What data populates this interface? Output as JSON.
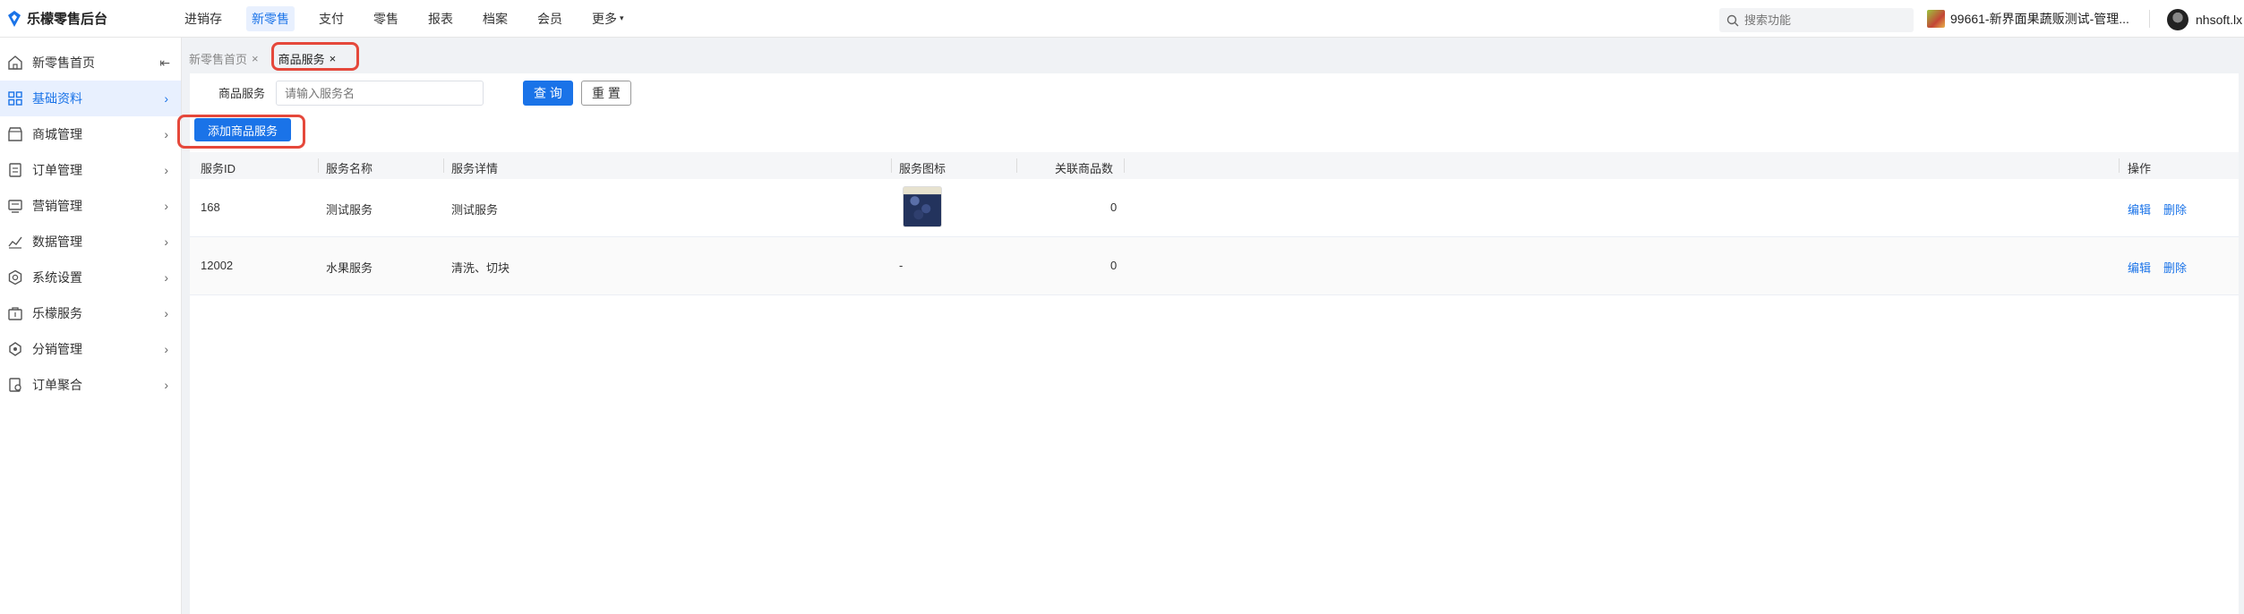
{
  "app": {
    "title": "乐檬零售后台"
  },
  "topnav": {
    "items": [
      "进销存",
      "新零售",
      "支付",
      "零售",
      "报表",
      "档案",
      "会员"
    ],
    "more": "更多"
  },
  "search": {
    "placeholder": "搜索功能"
  },
  "store": {
    "name": "99661-新界面果蔬贩测试-管理..."
  },
  "user": {
    "name": "nhsoft.lx"
  },
  "sidebar": {
    "items": [
      {
        "label": "新零售首页",
        "icon": "home-icon"
      },
      {
        "label": "基础资料",
        "icon": "grid-icon"
      },
      {
        "label": "商城管理",
        "icon": "store-icon"
      },
      {
        "label": "订单管理",
        "icon": "order-icon"
      },
      {
        "label": "营销管理",
        "icon": "marketing-icon"
      },
      {
        "label": "数据管理",
        "icon": "chart-icon"
      },
      {
        "label": "系统设置",
        "icon": "settings-icon"
      },
      {
        "label": "乐檬服务",
        "icon": "service-icon"
      },
      {
        "label": "分销管理",
        "icon": "distribution-icon"
      },
      {
        "label": "订单聚合",
        "icon": "aggregate-icon"
      }
    ]
  },
  "tabs": [
    {
      "label": "新零售首页"
    },
    {
      "label": "商品服务"
    }
  ],
  "filter": {
    "label": "商品服务",
    "placeholder": "请输入服务名",
    "query_button": "查 询",
    "reset_button": "重 置"
  },
  "add_button": "添加商品服务",
  "table": {
    "headers": [
      "服务ID",
      "服务名称",
      "服务详情",
      "服务图标",
      "关联商品数",
      "操作"
    ],
    "rows": [
      {
        "id": "168",
        "name": "测试服务",
        "detail": "测试服务",
        "icon": "[image]",
        "count": "0"
      },
      {
        "id": "12002",
        "name": "水果服务",
        "detail": "清洗、切块",
        "icon": "-",
        "count": "0"
      }
    ],
    "actions": {
      "edit": "编辑",
      "delete": "删除"
    }
  },
  "colors": {
    "primary": "#1a73e8",
    "highlight": "#e5483b"
  }
}
